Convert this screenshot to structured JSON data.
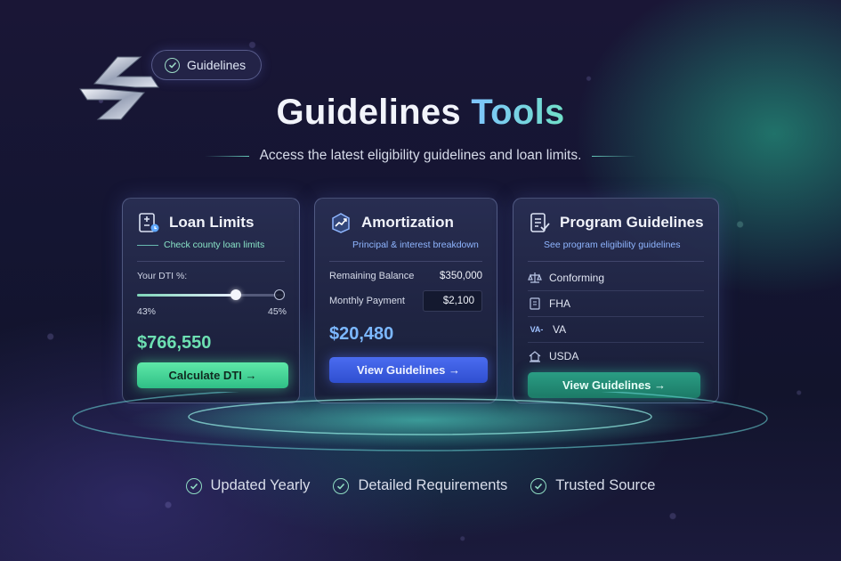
{
  "badge": {
    "label": "Guidelines",
    "icon": "check-circle-icon"
  },
  "header": {
    "title_main": "Guidelines",
    "title_accent": "Tools",
    "subtitle": "Access the latest eligibility guidelines and loan limits."
  },
  "cards": {
    "loan_limits": {
      "title": "Loan Limits",
      "subtitle": "Check county loan limits",
      "icon": "calculator-doc-icon",
      "dti_label": "Your DTI %:",
      "slider_min_label": "43%",
      "slider_max_label": "45%",
      "slider_level": 0.68,
      "amount": "$766,550",
      "button": "Calculate DTI →"
    },
    "amortization": {
      "title": "Amortization",
      "subtitle": "Principal & interest breakdown",
      "icon": "chart-box-icon",
      "rows": [
        {
          "label": "Remaining Balance",
          "value": "$350,000"
        },
        {
          "label": "Monthly Payment",
          "value": "$2,100"
        }
      ],
      "amount": "$20,480",
      "button": "View Guidelines →"
    },
    "program_guidelines": {
      "title": "Program Guidelines",
      "subtitle": "See program eligibility guidelines",
      "icon": "checklist-doc-icon",
      "items": [
        {
          "label": "Conforming",
          "icon": "scale-icon"
        },
        {
          "label": "FHA",
          "icon": "document-icon"
        },
        {
          "label": "VA",
          "icon": "va-logo-icon",
          "glyph": "VA-"
        },
        {
          "label": "USDA",
          "icon": "house-icon"
        }
      ],
      "button": "View Guidelines →"
    }
  },
  "features": [
    {
      "label": "Updated Yearly"
    },
    {
      "label": "Detailed Requirements"
    },
    {
      "label": "Trusted Source"
    }
  ],
  "colors": {
    "green_accent": "#6de0b2",
    "blue_accent": "#7cb8ff",
    "teal_button": "#2a9d84",
    "blue_button": "#3a5ce0"
  }
}
